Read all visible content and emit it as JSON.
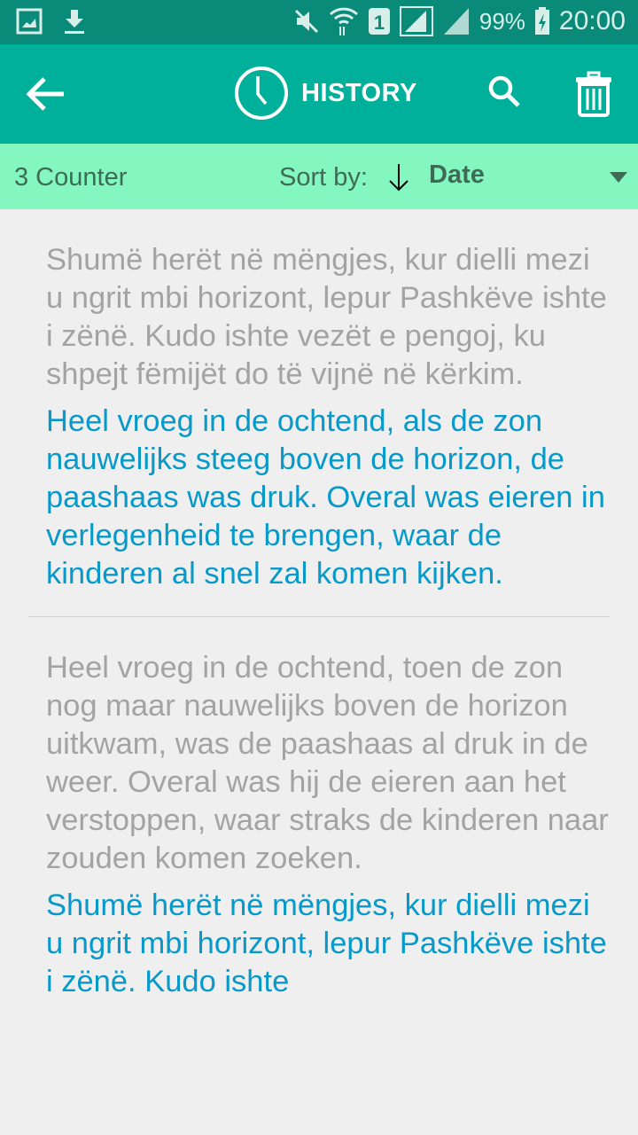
{
  "status_bar": {
    "battery": "99%",
    "time": "20:00",
    "icons": [
      "gallery-icon",
      "download-icon",
      "mute-icon",
      "wifi-icon",
      "sim-1-icon",
      "signal-icon",
      "signal-icon",
      "battery-charging-icon"
    ]
  },
  "toolbar": {
    "title": "HISTORY",
    "icons": [
      "back-arrow-icon",
      "clock-icon",
      "search-icon",
      "trash-icon"
    ]
  },
  "sort_bar": {
    "counter": "3 Counter",
    "sort_label": "Sort by:",
    "sort_value": "Date",
    "sort_direction": "descending"
  },
  "history": [
    {
      "source": "Shumë herët në mëngjes, kur dielli mezi u ngrit mbi horizont, lepur Pashkëve ishte i zënë. Kudo ishte vezët e pengoj, ku shpejt fëmijët do të vijnë në kërkim.",
      "translation": "Heel vroeg in de ochtend, als de zon nauwelijks steeg boven de horizon, de paashaas was druk. Overal was eieren in verlegenheid te brengen, waar de kinderen al snel zal komen kijken."
    },
    {
      "source": "Heel vroeg in de ochtend, toen de zon nog maar nauwelijks boven de horizon uitkwam, was de paashaas al druk in de weer. Overal was hij de eieren aan het verstoppen, waar straks de kinderen naar zouden komen zoeken.",
      "translation": "Shumë herët në mëngjes, kur dielli mezi u ngrit mbi horizont, lepur Pashkëve ishte i zënë. Kudo ishte"
    }
  ],
  "colors": {
    "status_bar": "#0a8a78",
    "toolbar": "#00b09b",
    "sort_bar": "#84f7c0",
    "source_text": "#a3a3a3",
    "translation_text": "#0699c9"
  }
}
